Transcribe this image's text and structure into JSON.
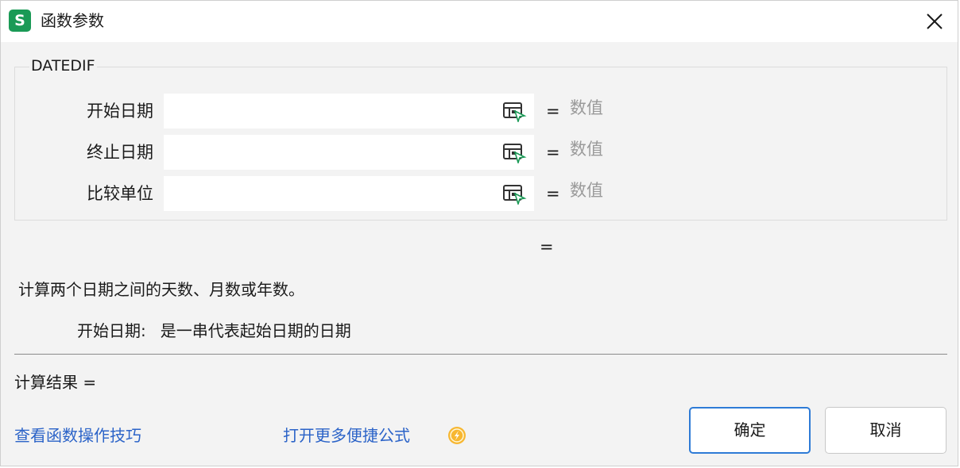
{
  "app_icon_letter": "S",
  "title": "函数参数",
  "function_name": "DATEDIF",
  "args": [
    {
      "label": "开始日期",
      "value": "",
      "eq": "=",
      "hint": "数值"
    },
    {
      "label": "终止日期",
      "value": "",
      "eq": "=",
      "hint": "数值"
    },
    {
      "label": "比较单位",
      "value": "",
      "eq": "=",
      "hint": "数值"
    }
  ],
  "result_eq": "=",
  "description": "计算两个日期之间的天数、月数或年数。",
  "arg_description": {
    "name": "开始日期:",
    "text": "是一串代表起始日期的日期"
  },
  "calc_result": "计算结果 =",
  "links": {
    "tips": "查看函数操作技巧",
    "more": "打开更多便捷公式"
  },
  "buttons": {
    "ok": "确定",
    "cancel": "取消"
  },
  "icons": {
    "app": "wps-spreadsheet-icon",
    "close": "close-icon",
    "ref": "range-select-icon",
    "coin": "coin-icon"
  },
  "colors": {
    "app_icon": "#1a9a56",
    "link": "#2b63c8",
    "ok_border": "#2e7bd6",
    "hint": "#9a9a9a"
  }
}
